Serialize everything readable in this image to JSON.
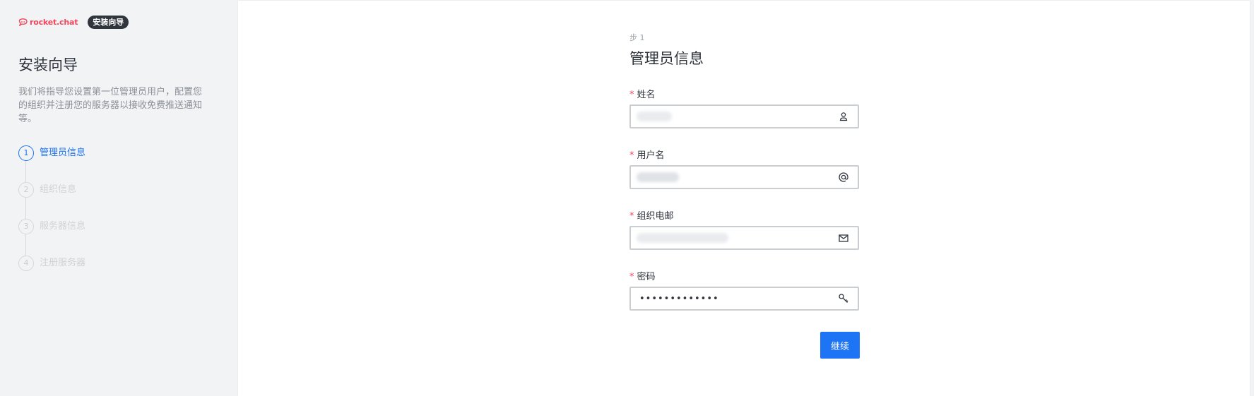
{
  "brand": {
    "logo_text": "rocket.chat",
    "badge": "安装向导",
    "brand_color": "#f5455c"
  },
  "sidebar": {
    "title": "安装向导",
    "description": "我们将指导您设置第一位管理员用户，配置您的组织并注册您的服务器以接收免费推送通知等。",
    "steps": [
      {
        "number": "1",
        "label": "管理员信息",
        "active": true
      },
      {
        "number": "2",
        "label": "组织信息",
        "active": false
      },
      {
        "number": "3",
        "label": "服务器信息",
        "active": false
      },
      {
        "number": "4",
        "label": "注册服务器",
        "active": false
      }
    ]
  },
  "form": {
    "step_label": "步 1",
    "title": "管理员信息",
    "fields": [
      {
        "label": "姓名",
        "required_mark": "*",
        "value": "",
        "icon": "user-icon"
      },
      {
        "label": "用户名",
        "required_mark": "*",
        "value": "",
        "icon": "at-icon"
      },
      {
        "label": "组织电邮",
        "required_mark": "*",
        "value": "",
        "icon": "mail-icon"
      },
      {
        "label": "密码",
        "required_mark": "*",
        "value": "•••••••••••••",
        "icon": "key-icon"
      }
    ],
    "continue_label": "继续"
  },
  "colors": {
    "accent": "#1d74f5",
    "required": "#f5455c"
  }
}
